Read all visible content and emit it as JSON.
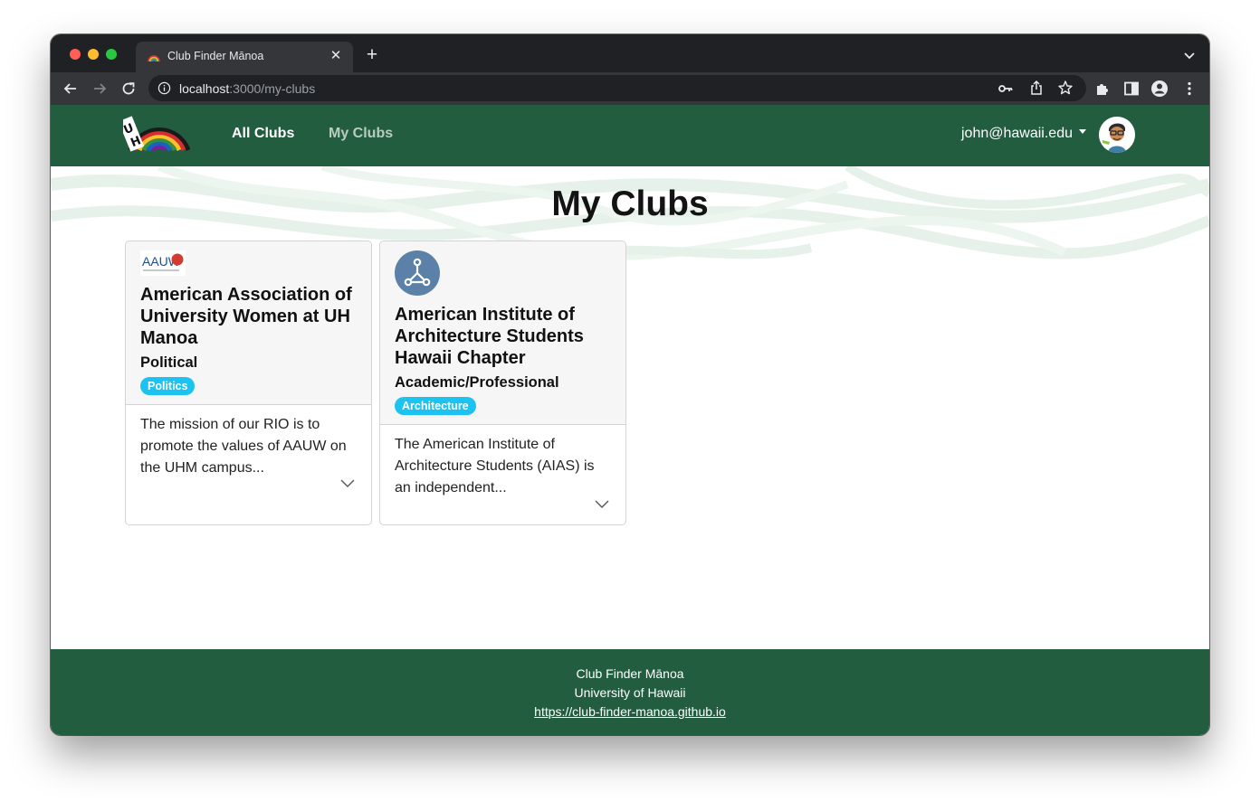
{
  "browser": {
    "tab_title": "Club Finder Mānoa",
    "new_tab_label": "+",
    "close_label": "✕",
    "url_host": "localhost",
    "url_path": ":3000/my-clubs"
  },
  "navbar": {
    "links": [
      {
        "label": "All Clubs",
        "active": true
      },
      {
        "label": "My Clubs",
        "active": false
      }
    ],
    "user_email": "john@hawaii.edu"
  },
  "page": {
    "title": "My Clubs"
  },
  "clubs": [
    {
      "logo_text": "AAUW",
      "name": "American Association of University Women at UH Manoa",
      "type": "Political",
      "tag": "Politics",
      "description": "The mission of our RIO is to promote the values of AAUW on the UHM campus..."
    },
    {
      "logo_icon": "node-graph-icon",
      "name": "American Institute of Architecture Students Hawaii Chapter",
      "type": "Academic/Professional",
      "tag": "Architecture",
      "description": "The American Institute of Architecture Students (AIAS) is an independent..."
    }
  ],
  "footer": {
    "line1": "Club Finder Mānoa",
    "line2": "University of Hawaii",
    "link": "https://club-finder-manoa.github.io"
  },
  "colors": {
    "brand_green": "#225d40",
    "badge_blue": "#1cc3f0",
    "wave_green": "#e6f1e9"
  }
}
